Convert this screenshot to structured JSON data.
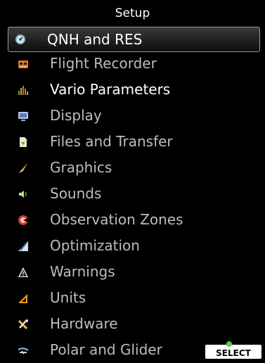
{
  "title": "Setup",
  "menu": {
    "items": [
      {
        "label": "QNH and RES",
        "icon": "qnh-icon"
      },
      {
        "label": "Flight Recorder",
        "icon": "flight-recorder-icon"
      },
      {
        "label": "Vario Parameters",
        "icon": "vario-icon"
      },
      {
        "label": "Display",
        "icon": "display-icon"
      },
      {
        "label": "Files and Transfer",
        "icon": "files-icon"
      },
      {
        "label": "Graphics",
        "icon": "graphics-icon"
      },
      {
        "label": "Sounds",
        "icon": "sounds-icon"
      },
      {
        "label": "Observation Zones",
        "icon": "observation-zones-icon"
      },
      {
        "label": "Optimization",
        "icon": "optimization-icon"
      },
      {
        "label": "Warnings",
        "icon": "warnings-icon"
      },
      {
        "label": "Units",
        "icon": "units-icon"
      },
      {
        "label": "Hardware",
        "icon": "hardware-icon"
      },
      {
        "label": "Polar and Glider",
        "icon": "polar-glider-icon"
      }
    ]
  },
  "softkey": {
    "label": "SELECT"
  },
  "colors": {
    "background": "#000000",
    "text": "#bdbdbd",
    "highlight_text": "#ffffff",
    "selection_border": "#9a9a9a"
  }
}
